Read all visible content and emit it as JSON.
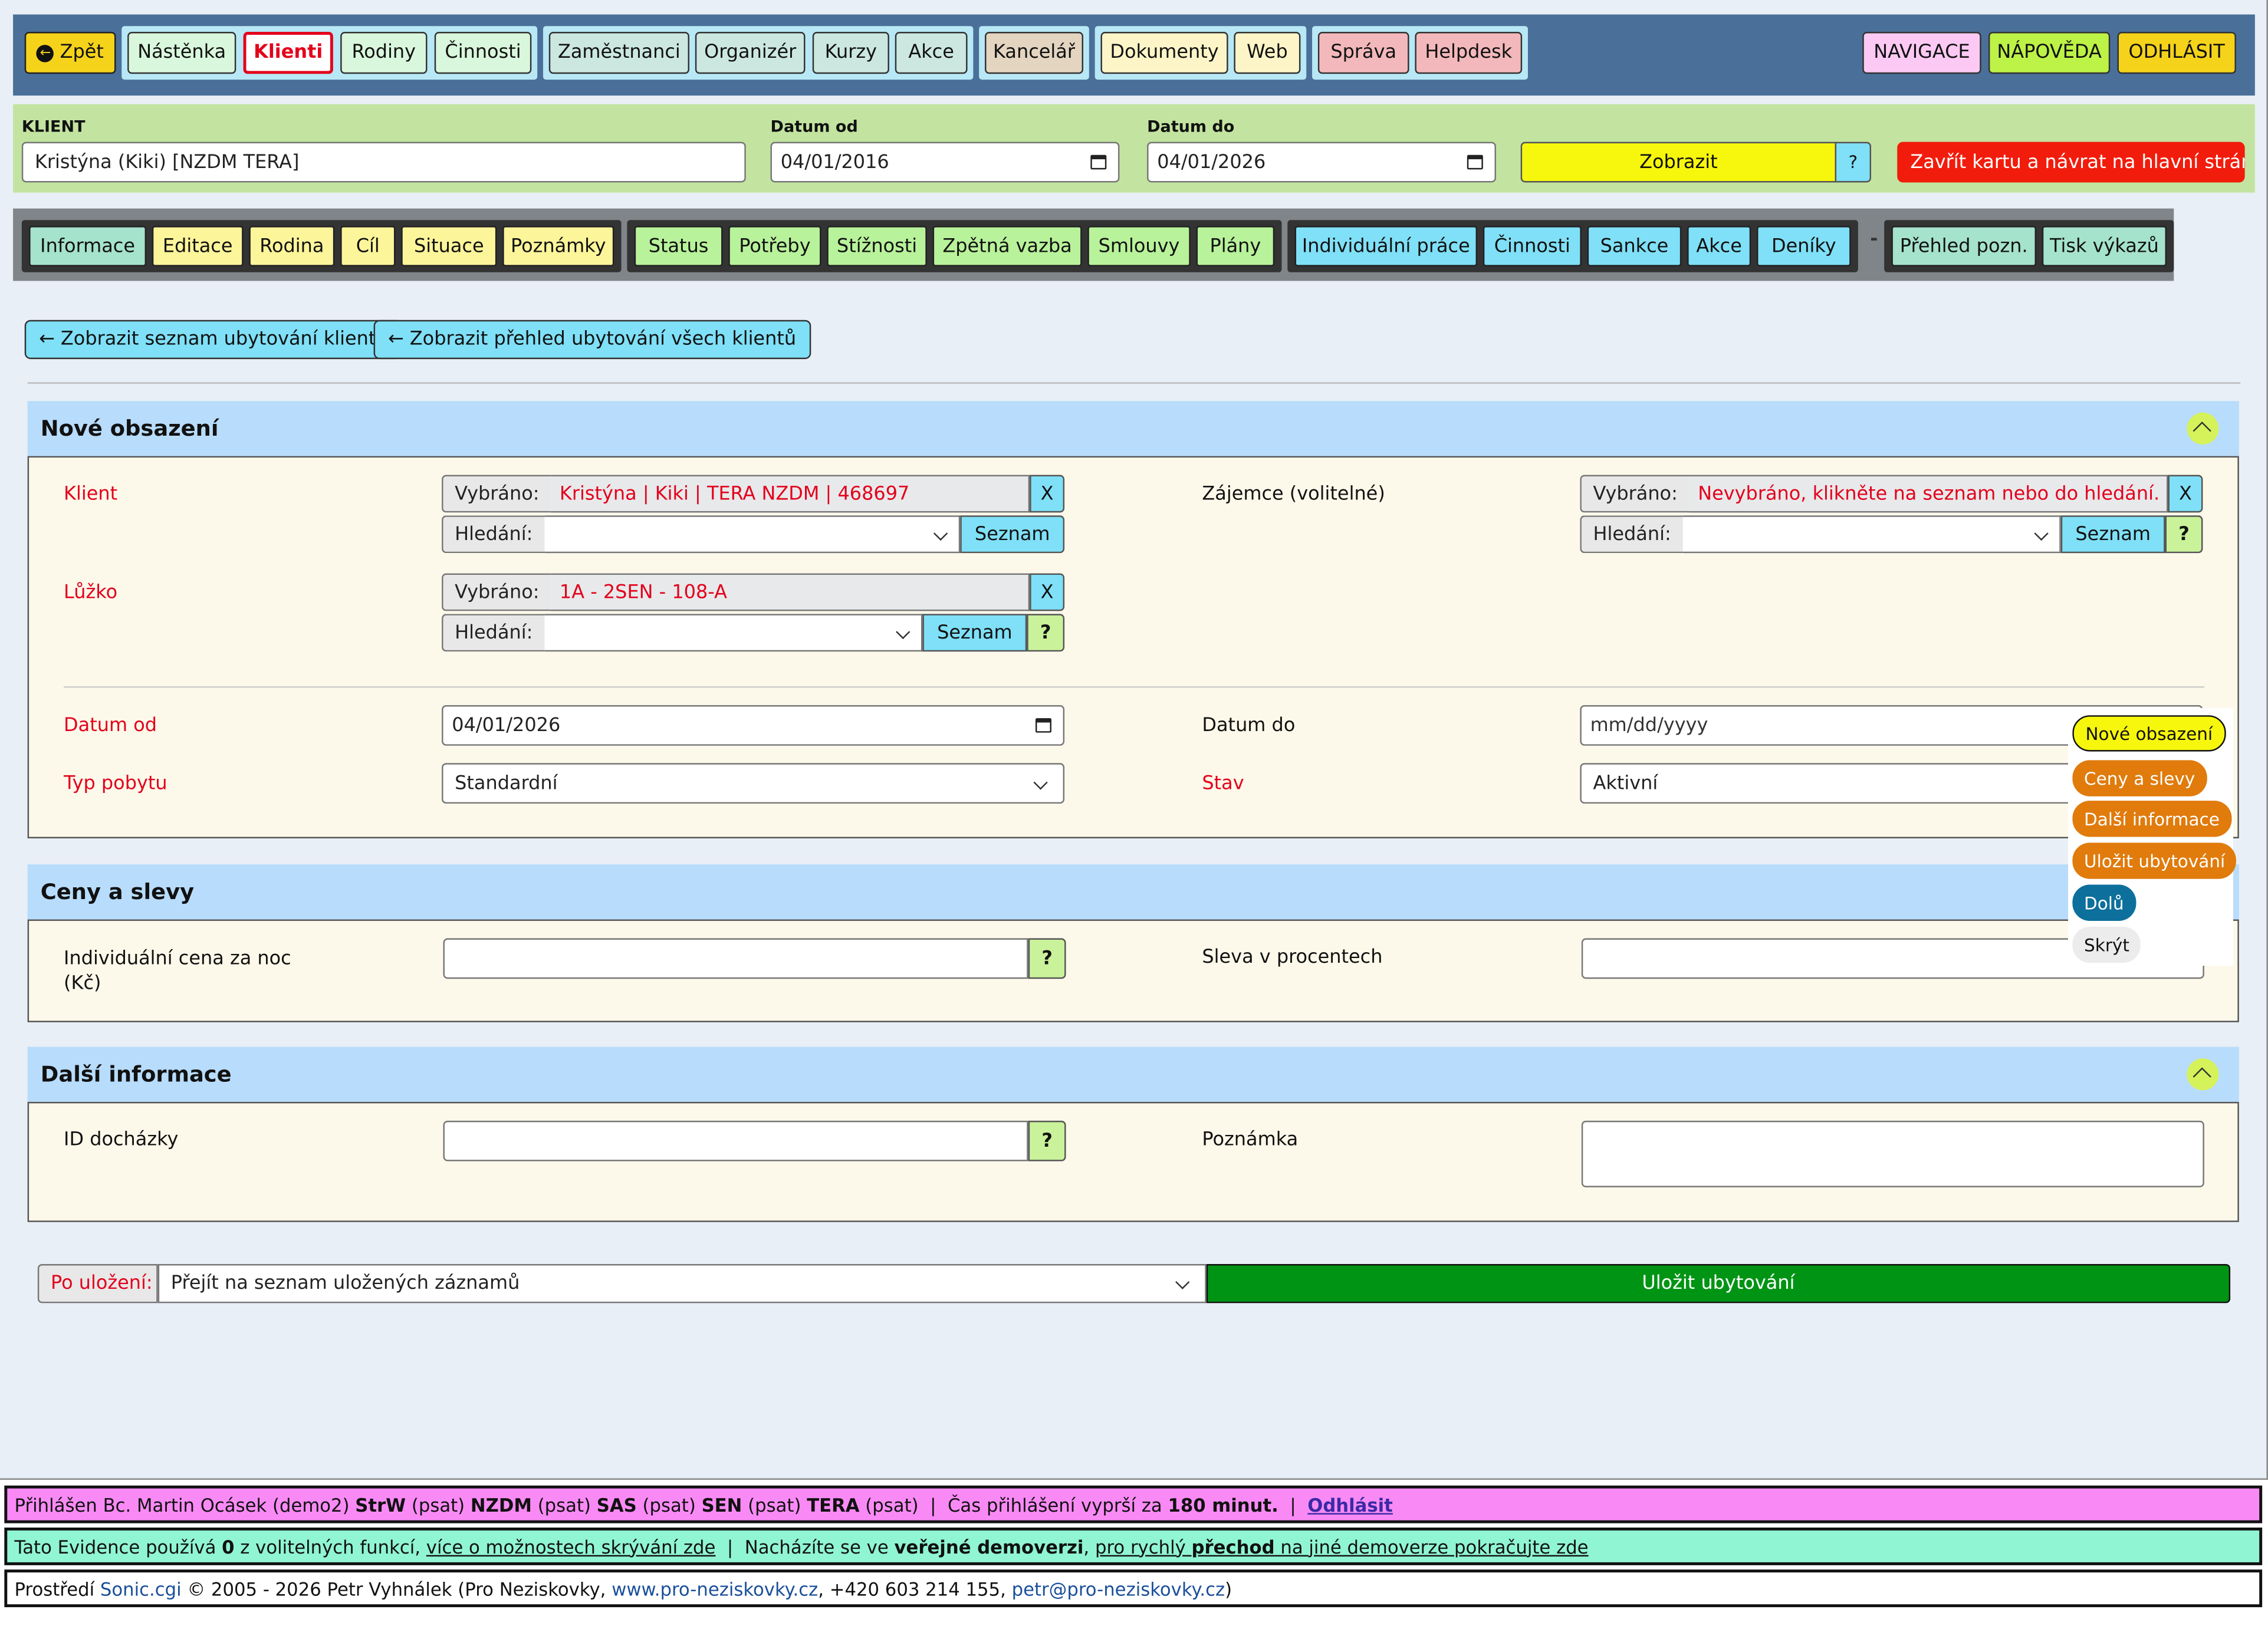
{
  "topnav": {
    "back": "Zpět",
    "group1": [
      "Nástěnka",
      "Klienti",
      "Rodiny",
      "Činnosti"
    ],
    "group2": [
      "Zaměstnanci",
      "Organizér",
      "Kurzy",
      "Akce"
    ],
    "group3": [
      "Kancelář"
    ],
    "group4": [
      "Dokumenty",
      "Web"
    ],
    "group5": [
      "Správa",
      "Helpdesk"
    ],
    "right": [
      "NAVIGACE",
      "NÁPOVĚDA",
      "ODHLÁSIT"
    ],
    "active": "Klienti"
  },
  "filter": {
    "klient_label": "KLIENT",
    "klient_value": "Kristýna (Kiki) [NZDM TERA]",
    "datum_od_label": "Datum od",
    "datum_od_value": "04/01/2016",
    "datum_do_label": "Datum do",
    "datum_do_value": "04/01/2026",
    "zobrazit": "Zobrazit",
    "help": "?",
    "zavrit": "Zavřít kartu a návrat na hlavní stránku"
  },
  "subnav": {
    "group1": [
      "Informace",
      "Editace",
      "Rodina",
      "Cíl",
      "Situace",
      "Poznámky"
    ],
    "group2": [
      "Status",
      "Potřeby",
      "Stížnosti",
      "Zpětná vazba",
      "Smlouvy",
      "Plány"
    ],
    "group3": [
      "Individuální práce",
      "Činnosti",
      "Sankce",
      "Akce",
      "Deníky"
    ],
    "sep": "-",
    "group4": [
      "Přehled pozn.",
      "Tisk výkazů"
    ]
  },
  "actions": {
    "seznam_klienta": "Zobrazit seznam ubytování klienta",
    "prehled_vsech": "Zobrazit přehled ubytování všech klientů"
  },
  "section_nove": {
    "title": "Nové obsazení",
    "klient_label": "Klient",
    "klient_vybrano_cap": "Vybráno:",
    "klient_vybrano_val": "Kristýna | Kiki | TERA NZDM | 468697",
    "hledani_cap": "Hledání:",
    "seznam": "Seznam",
    "x": "X",
    "q": "?",
    "zajemce_label": "Zájemce (volitelné)",
    "zajemce_vybrano_val": "Nevybráno, klikněte na seznam nebo do hledání.",
    "luzko_label": "Lůžko",
    "luzko_vybrano_val": "1A - 2SEN - 108-A",
    "datum_od_label": "Datum od",
    "datum_od_value": "04/01/2026",
    "datum_do_label": "Datum do",
    "datum_do_placeholder": "mm/dd/yyyy",
    "typ_label": "Typ pobytu",
    "typ_value": "Standardní",
    "stav_label": "Stav",
    "stav_value": "Aktivní"
  },
  "section_ceny": {
    "title": "Ceny a slevy",
    "cena_label": "Individuální cena za noc",
    "cena_label2": "(Kč)",
    "sleva_label": "Sleva v procentech",
    "q": "?"
  },
  "section_dalsi": {
    "title": "Další informace",
    "id_label": "ID docházky",
    "poznamka_label": "Poznámka",
    "q": "?"
  },
  "save": {
    "po_ulozeni": "Po uložení:",
    "po_ulozeni_value": "Přejít na seznam uložených záznamů",
    "ulozit": "Uložit ubytování"
  },
  "side_menu": [
    "Nové obsazení",
    "Ceny a slevy",
    "Další informace",
    "Uložit ubytování",
    "Dolů",
    "Skrýt"
  ],
  "footer": {
    "login_prefix": "Přihlášen Bc. Martin Ocásek (demo2) ",
    "login_orgs": [
      [
        "StrW",
        "(psat)"
      ],
      [
        "NZDM",
        "(psat)"
      ],
      [
        "SAS",
        "(psat)"
      ],
      [
        "SEN",
        "(psat)"
      ],
      [
        "TERA",
        "(psat)"
      ]
    ],
    "login_expire_prefix": "  |  Čas přihlášení vyprší za ",
    "login_expire_value": "180 minut.",
    "login_logout": "Odhlásit",
    "info_1": "Tato Evidence používá ",
    "info_count": "0",
    "info_2": " z volitelných funkcí, ",
    "info_link1": "více o možnostech skrývání zde",
    "info_3": "  |  Nacházíte se ve ",
    "info_bold": "veřejné demoverzi",
    "info_4": ", ",
    "info_link2a": "pro rychlý ",
    "info_link2b": "přechod",
    "info_link2c": " na jiné demoverze pokračujte zde",
    "copy_1": "Prostředí ",
    "copy_sonic": "Sonic.cgi",
    "copy_2": " © 2005 - 2026 Petr Vyhnálek (Pro Neziskovky, ",
    "copy_web": "www.pro-neziskovky.cz",
    "copy_3": ", +420 603 214 155, ",
    "copy_mail": "petr@pro-neziskovky.cz",
    "copy_4": ")"
  },
  "colors": {
    "topnav_bg": "#4a6f99",
    "filter_bg": "#c2e4a0",
    "save_green": "#009414",
    "close_red": "#f21c0c"
  }
}
